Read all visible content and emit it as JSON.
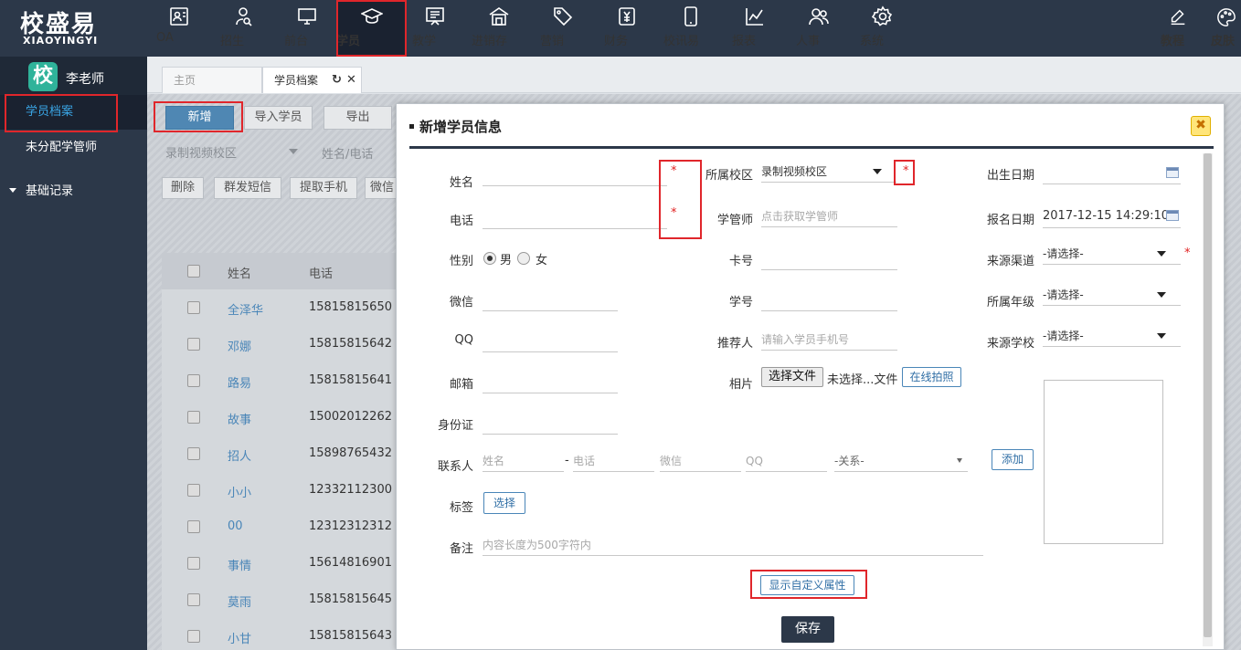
{
  "brand": {
    "name_cn": "校盛易",
    "name_en": "XIAOYINGYI"
  },
  "nav": [
    {
      "label": "OA",
      "icon": "contacts-icon"
    },
    {
      "label": "招生",
      "icon": "person-search-icon"
    },
    {
      "label": "前台",
      "icon": "monitor-icon"
    },
    {
      "label": "学员",
      "icon": "graduation-cap-icon",
      "active": true
    },
    {
      "label": "教学",
      "icon": "board-icon"
    },
    {
      "label": "进销存",
      "icon": "store-icon"
    },
    {
      "label": "营销",
      "icon": "tag-icon"
    },
    {
      "label": "财务",
      "icon": "money-icon"
    },
    {
      "label": "校讯易",
      "icon": "phone-icon"
    },
    {
      "label": "报表",
      "icon": "chart-icon"
    },
    {
      "label": "人事",
      "icon": "people-icon"
    },
    {
      "label": "系统",
      "icon": "gear-icon"
    }
  ],
  "nav_right": [
    {
      "label": "教程",
      "icon": "edit-icon"
    },
    {
      "label": "皮肤",
      "icon": "palette-icon"
    }
  ],
  "sidebar": {
    "badge": "校",
    "user": "李老师",
    "items": [
      {
        "label": "学员档案",
        "active": true
      },
      {
        "label": "未分配学管师"
      }
    ],
    "group": "基础记录"
  },
  "tabs": [
    {
      "label": "主页"
    },
    {
      "label": "学员档案",
      "active": true
    }
  ],
  "toolbar": {
    "add": "新增",
    "import": "导入学员",
    "export": "导出",
    "campus_filter": "录制视频校区",
    "search_placeholder": "姓名/电话",
    "delete": "删除",
    "sms": "群发短信",
    "extract_phone": "提取手机",
    "wechat": "微信"
  },
  "table": {
    "headers": {
      "name": "姓名",
      "phone": "电话"
    },
    "rows": [
      {
        "name": "全泽华",
        "phone": "15815815650"
      },
      {
        "name": "邓娜",
        "phone": "15815815642"
      },
      {
        "name": "路易",
        "phone": "15815815641"
      },
      {
        "name": "故事",
        "phone": "15002012262"
      },
      {
        "name": "招人",
        "phone": "15898765432"
      },
      {
        "name": "小小",
        "phone": "12332112300"
      },
      {
        "name": "00",
        "phone": "12312312312"
      },
      {
        "name": "事情",
        "phone": "15614816901"
      },
      {
        "name": "莫雨",
        "phone": "15815815645"
      },
      {
        "name": "小甘",
        "phone": "15815815643"
      }
    ]
  },
  "modal": {
    "title": "新增学员信息",
    "close": "✖",
    "fields": {
      "name": "姓名",
      "phone": "电话",
      "gender": "性别",
      "gender_male": "男",
      "gender_female": "女",
      "wechat": "微信",
      "qq": "QQ",
      "email": "邮箱",
      "id_card": "身份证",
      "contact": "联系人",
      "tag": "标签",
      "remark": "备注",
      "campus": "所属校区",
      "campus_value": "录制视频校区",
      "manager": "学管师",
      "manager_placeholder": "点击获取学管师",
      "card_no": "卡号",
      "student_no": "学号",
      "referrer": "推荐人",
      "referrer_placeholder": "请输入学员手机号",
      "photo": "相片",
      "photo_choose": "选择文件",
      "photo_none": "未选择...文件",
      "photo_online": "在线拍照",
      "birth": "出生日期",
      "enroll_date": "报名日期",
      "enroll_date_value": "2017-12-15 14:29:10",
      "source_channel": "来源渠道",
      "grade": "所属年级",
      "source_school": "来源学校",
      "select_placeholder": "-请选择-"
    },
    "contact_placeholders": {
      "name": "姓名",
      "phone": "电话",
      "wechat": "微信",
      "qq": "QQ",
      "relation": "-关系-"
    },
    "contact_add": "添加",
    "tag_select": "选择",
    "remark_placeholder": "内容长度为500字符内",
    "required_mark": "*",
    "contact_dash": "-",
    "custom_attr": "显示自定义属性",
    "save": "保存"
  }
}
